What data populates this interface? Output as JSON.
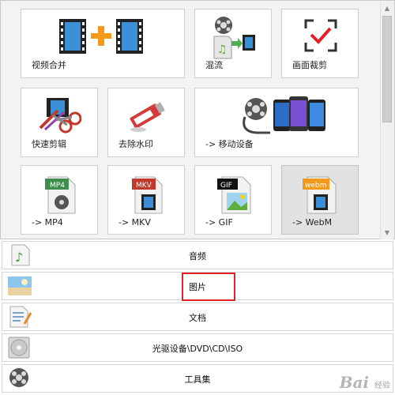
{
  "tiles": [
    {
      "label": "视频合并",
      "icon": "video-merge-icon"
    },
    {
      "label": "混流",
      "icon": "mux-icon"
    },
    {
      "label": "画面裁剪",
      "icon": "crop-icon"
    },
    {
      "label": "快速剪辑",
      "icon": "quick-clip-icon"
    },
    {
      "label": "去除水印",
      "icon": "remove-watermark-icon"
    },
    {
      "label": "-> 移动设备",
      "icon": "mobile-device-icon"
    },
    {
      "label": "-> MP4",
      "icon": "mp4-file-icon",
      "badge": "MP4"
    },
    {
      "label": "-> MKV",
      "icon": "mkv-file-icon",
      "badge": "MKV"
    },
    {
      "label": "-> GIF",
      "icon": "gif-file-icon",
      "badge": "GIF"
    },
    {
      "label": "-> WebM",
      "icon": "webm-file-icon",
      "badge": "webm",
      "selected": true
    }
  ],
  "categories": [
    {
      "label": "音频",
      "icon": "audio-icon"
    },
    {
      "label": "图片",
      "icon": "picture-icon"
    },
    {
      "label": "文档",
      "icon": "document-icon"
    },
    {
      "label": "光驱设备\\DVD\\CD\\ISO",
      "icon": "optical-drive-icon"
    },
    {
      "label": "工具集",
      "icon": "toolbox-icon"
    }
  ],
  "watermark": {
    "text": "Bai",
    "suffix": "经验"
  },
  "colors": {
    "highlight": "#e0222a",
    "accent_orange": "#f39a1b",
    "film_blue": "#2a5d8f"
  }
}
